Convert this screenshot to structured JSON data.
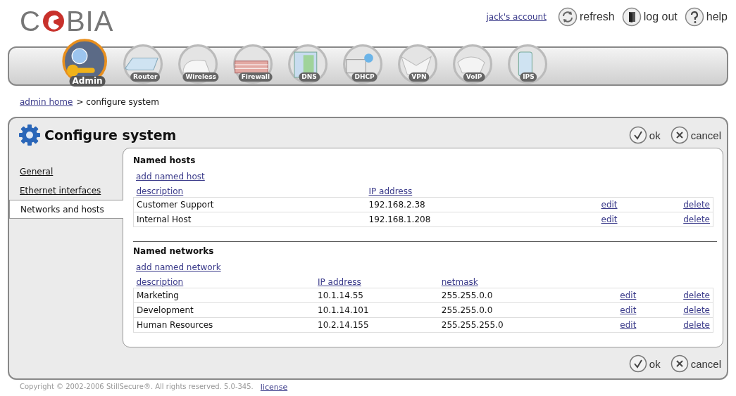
{
  "header": {
    "logo": {
      "left": "C",
      "right": "BIA"
    },
    "account_link": "jack's account",
    "actions": [
      {
        "kind": "refresh",
        "label": "refresh"
      },
      {
        "kind": "logout",
        "label": "log out"
      },
      {
        "kind": "help",
        "label": "help"
      }
    ]
  },
  "nav": [
    {
      "label": "Admin",
      "selected": true
    },
    {
      "label": "Router",
      "selected": false
    },
    {
      "label": "Wireless",
      "selected": false
    },
    {
      "label": "Firewall",
      "selected": false
    },
    {
      "label": "DNS",
      "selected": false
    },
    {
      "label": "DHCP",
      "selected": false
    },
    {
      "label": "VPN",
      "selected": false
    },
    {
      "label": "VoIP",
      "selected": false
    },
    {
      "label": "IPS",
      "selected": false
    }
  ],
  "breadcrumb": {
    "link": "admin home",
    "current": "> configure system"
  },
  "panel": {
    "title": "Configure system",
    "top_buttons": [
      {
        "kind": "ok",
        "label": "ok"
      },
      {
        "kind": "cancel",
        "label": "cancel"
      }
    ],
    "bottom_buttons": [
      {
        "kind": "ok",
        "label": "ok"
      },
      {
        "kind": "cancel",
        "label": "cancel"
      }
    ]
  },
  "sidebar": {
    "items": [
      {
        "label": "General",
        "selected": false
      },
      {
        "label": "Ethernet interfaces",
        "selected": false
      },
      {
        "label": "Networks and hosts",
        "selected": true
      }
    ]
  },
  "sections": [
    {
      "title": "Named hosts",
      "add_link": "add named host",
      "columns": [
        "description",
        "IP address"
      ],
      "rows": [
        {
          "cells": [
            "Customer Support",
            "192.168.2.38"
          ],
          "actions": [
            "edit",
            "delete"
          ]
        },
        {
          "cells": [
            "Internal Host",
            "192.168.1.208"
          ],
          "actions": [
            "edit",
            "delete"
          ]
        }
      ]
    },
    {
      "title": "Named networks",
      "add_link": "add named network",
      "columns": [
        "description",
        "IP address",
        "netmask"
      ],
      "rows": [
        {
          "cells": [
            "Marketing",
            "10.1.14.55",
            "255.255.0.0"
          ],
          "actions": [
            "edit",
            "delete"
          ]
        },
        {
          "cells": [
            "Development",
            "10.1.14.101",
            "255.255.0.0"
          ],
          "actions": [
            "edit",
            "delete"
          ]
        },
        {
          "cells": [
            "Human Resources",
            "10.2.14.155",
            "255.255.255.0"
          ],
          "actions": [
            "edit",
            "delete"
          ]
        }
      ]
    }
  ],
  "footer": {
    "copyright": "Copyright © 2002-2006 StillSecure®. All rights reserved. 5.0-345.",
    "license_link": "license"
  }
}
